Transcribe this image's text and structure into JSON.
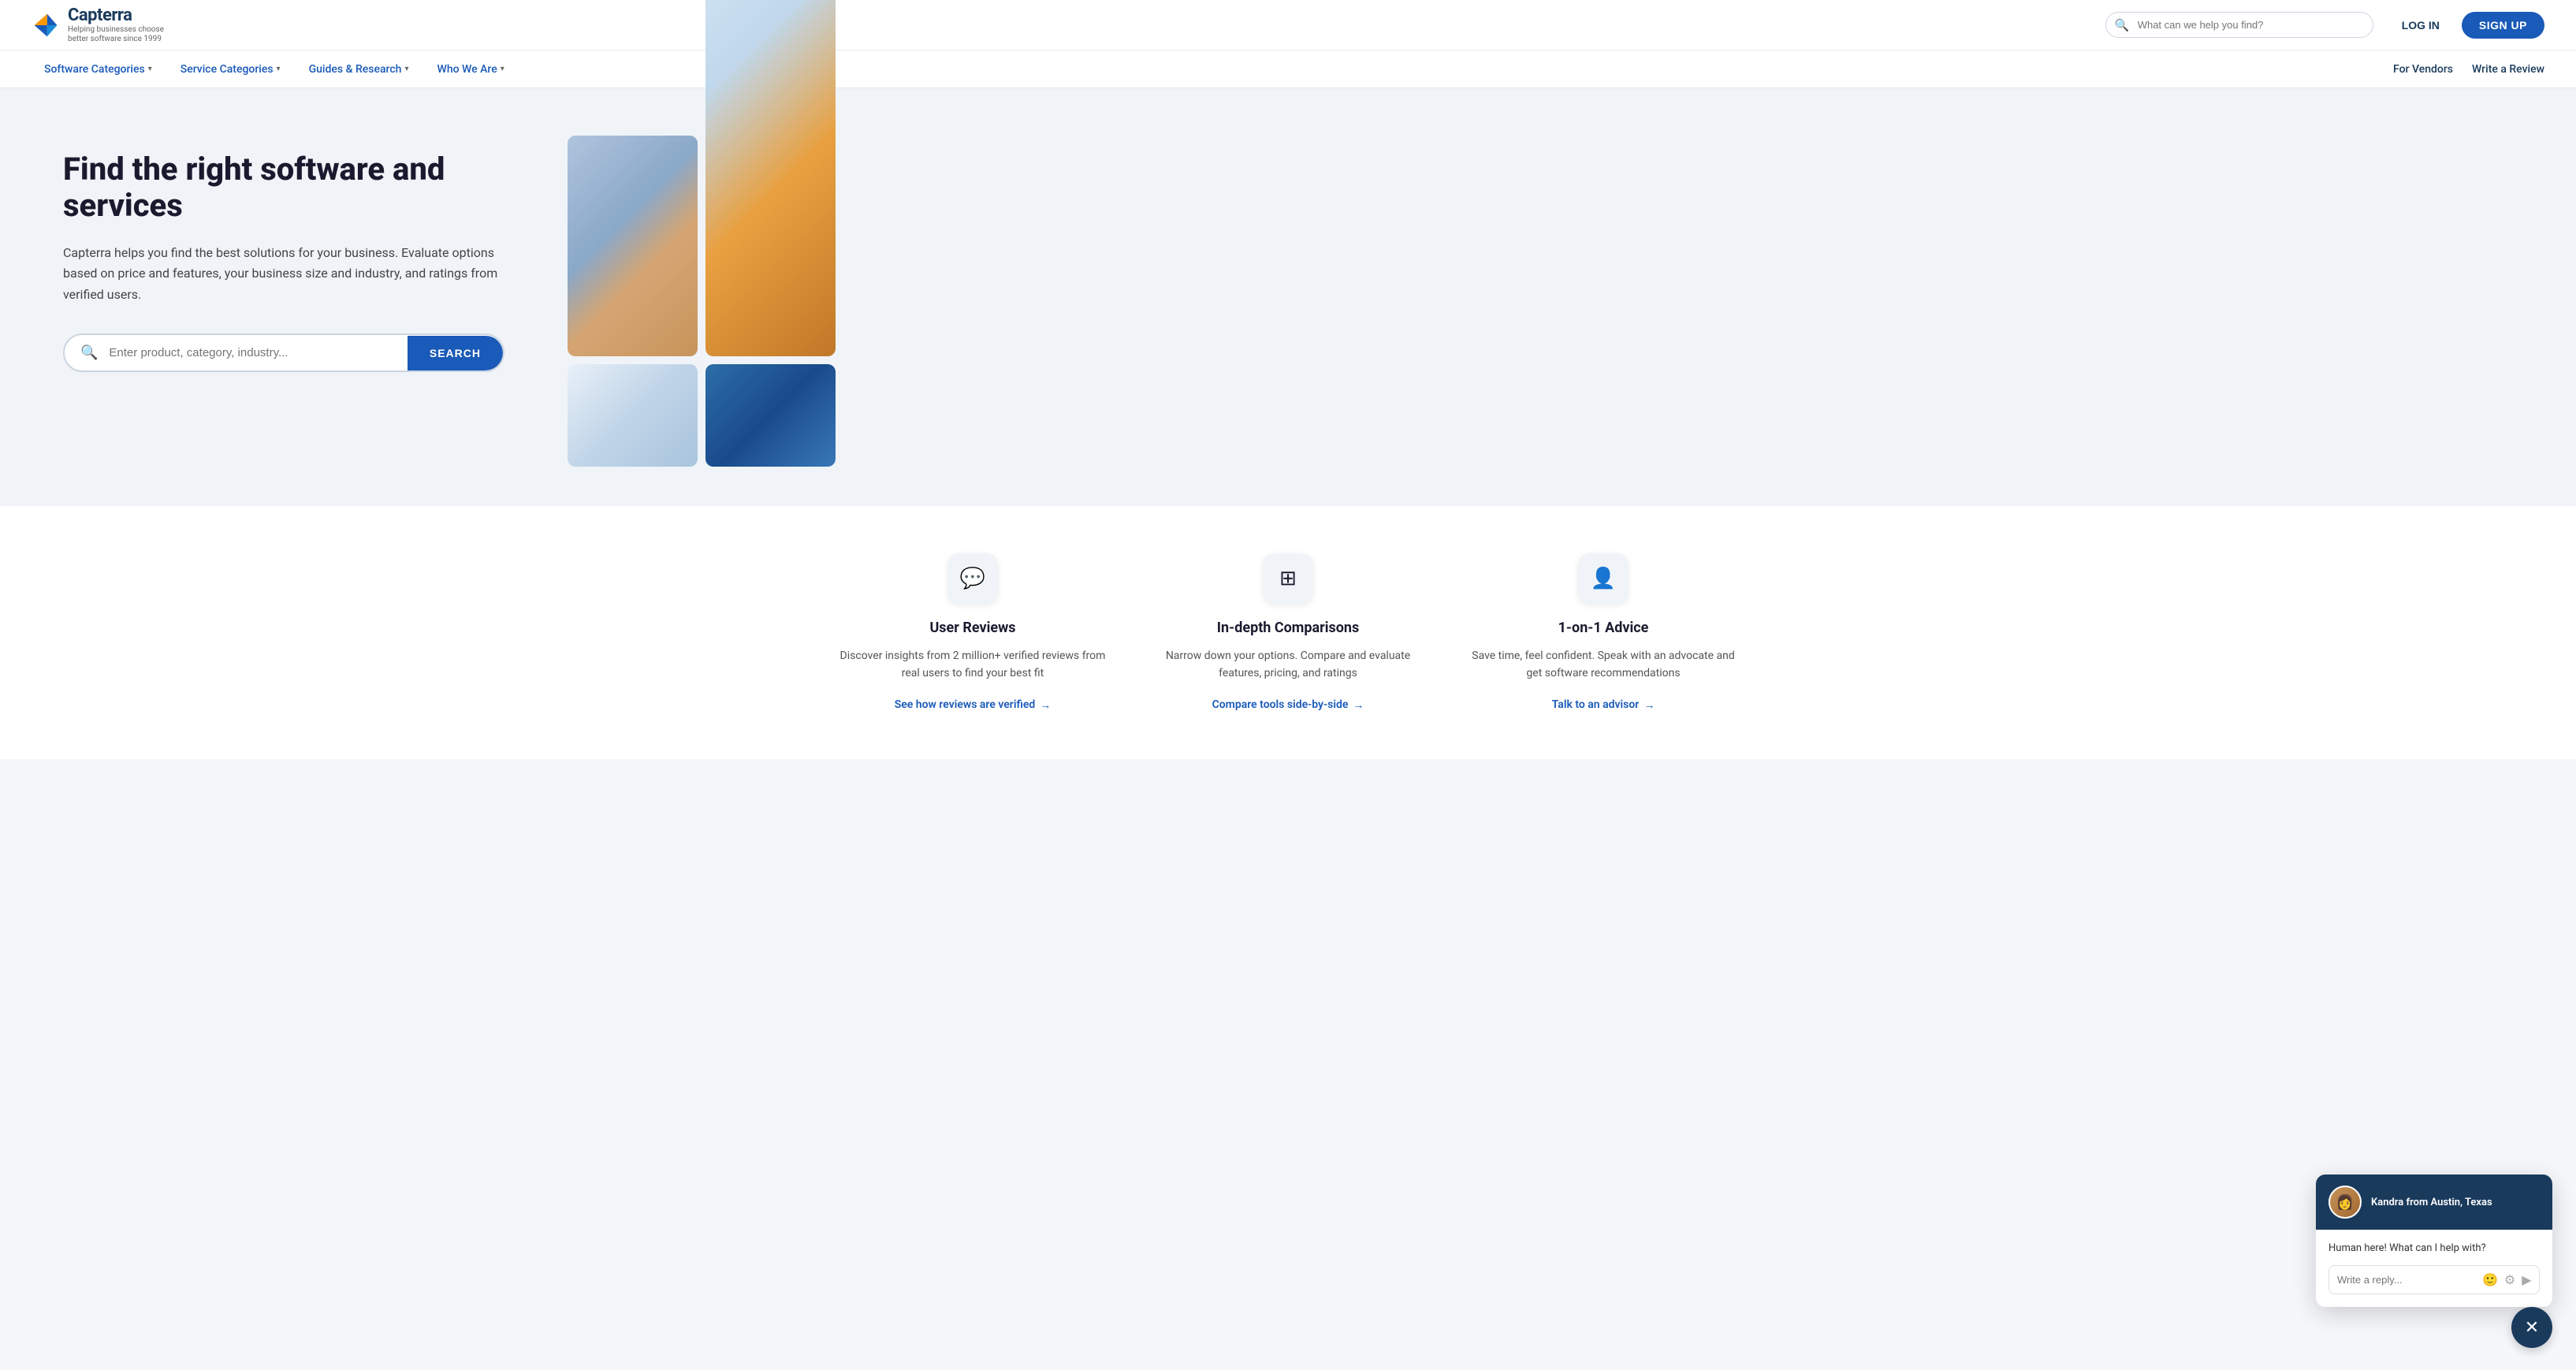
{
  "header": {
    "logo_brand": "Capterra",
    "logo_tagline": "Helping businesses choose\nbetter software since 1999",
    "search_placeholder": "What can we help you find?",
    "login_label": "LOG IN",
    "signup_label": "SIGN UP"
  },
  "nav": {
    "items": [
      {
        "label": "Software Categories",
        "has_dropdown": true
      },
      {
        "label": "Service Categories",
        "has_dropdown": true
      },
      {
        "label": "Guides & Research",
        "has_dropdown": true
      },
      {
        "label": "Who We Are",
        "has_dropdown": true
      }
    ],
    "right_items": [
      {
        "label": "For Vendors"
      },
      {
        "label": "Write a Review"
      }
    ]
  },
  "hero": {
    "title": "Find the right software and services",
    "subtitle": "Capterra helps you find the best solutions for your business. Evaluate options based on price and features, your business size and industry, and ratings from verified users.",
    "search_placeholder": "Enter product, category, industry...",
    "search_button_label": "SEARCH"
  },
  "features": [
    {
      "icon": "💬",
      "title": "User Reviews",
      "description": "Discover insights from 2 million+ verified reviews from real users to find your best fit",
      "link_label": "See how reviews are verified",
      "link_arrow": "→"
    },
    {
      "icon": "⊞",
      "title": "In-depth Comparisons",
      "description": "Narrow down your options. Compare and evaluate features, pricing, and ratings",
      "link_label": "Compare tools side-by-side",
      "link_arrow": "→"
    },
    {
      "icon": "👤",
      "title": "1-on-1 Advice",
      "description": "Save time, feel confident. Speak with an advocate and get software recommendations",
      "link_label": "Talk to an advisor",
      "link_arrow": "→"
    }
  ],
  "chat": {
    "agent_name": "Kandra from Austin, Texas",
    "message": "Human here! What can I help with?",
    "input_placeholder": "Write a reply...",
    "close_icon": "✕"
  }
}
